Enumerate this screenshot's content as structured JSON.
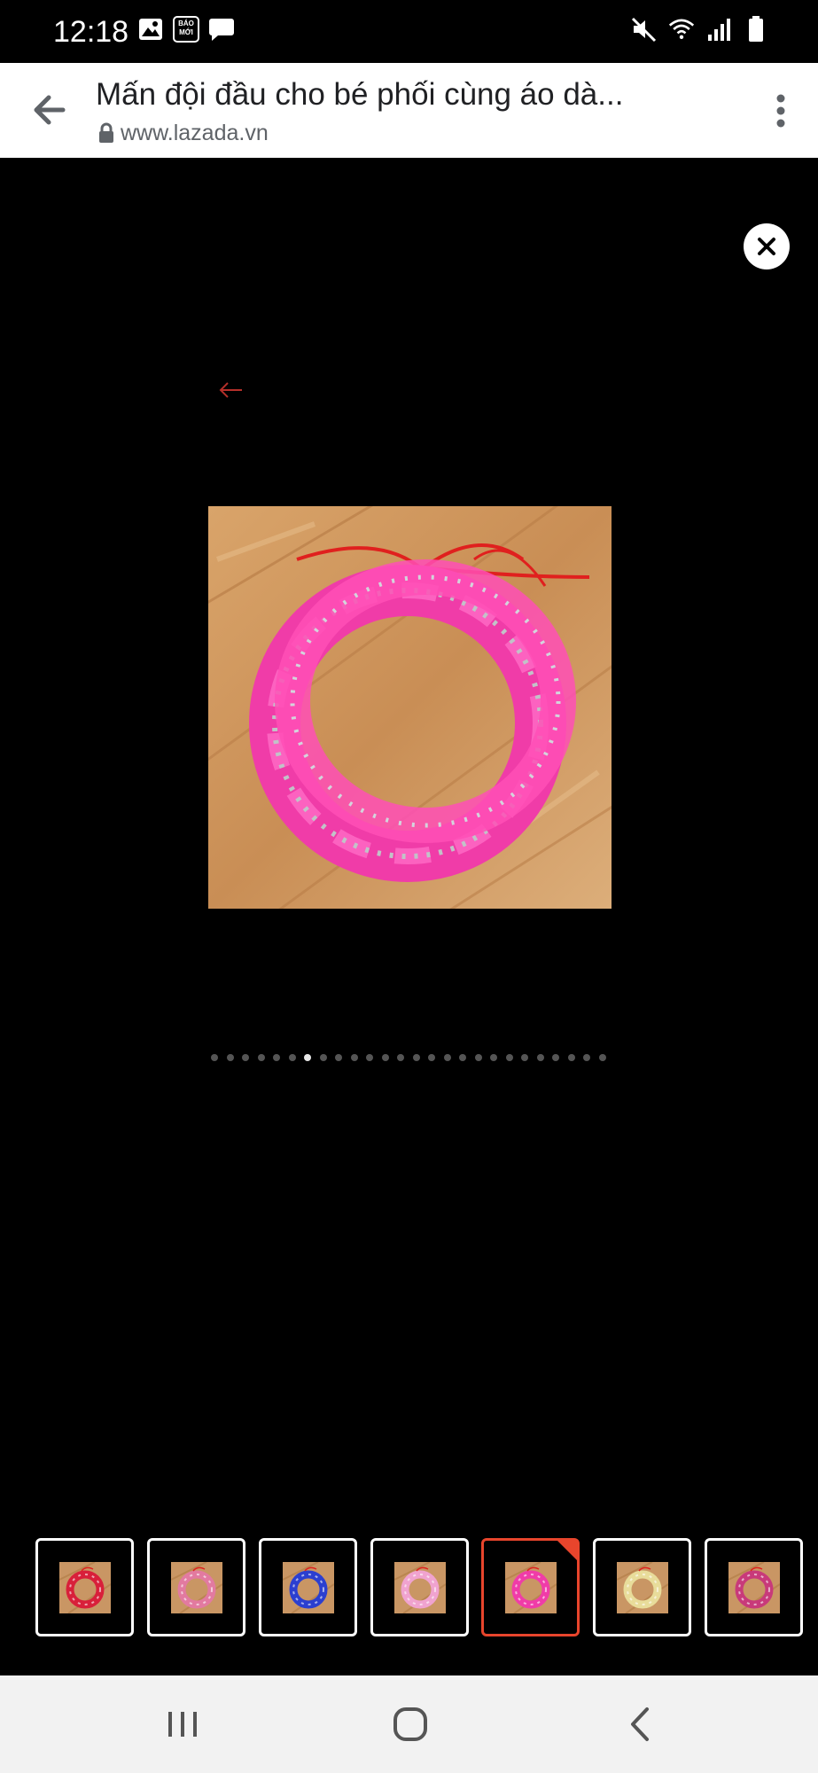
{
  "status_bar": {
    "time": "12:18",
    "left_icons": [
      "image-icon",
      "baomoi-icon",
      "message-icon"
    ],
    "baomoi_line1": "BÁO",
    "baomoi_line2": "MỚI",
    "right_icons": [
      "mute-icon",
      "wifi-icon",
      "signal-icon",
      "battery-icon"
    ]
  },
  "browser": {
    "title": "Mấn đội đầu cho bé phối cùng áo dà...",
    "url": "www.lazada.vn",
    "back_icon": "arrow-left-icon",
    "lock_icon": "lock-icon",
    "menu_icon": "more-vertical-icon"
  },
  "gallery": {
    "close_icon": "close-icon",
    "prev_icon": "arrow-left-icon",
    "main_image": "pink-braided-headband-photo",
    "dot_count": 26,
    "active_dot": 6,
    "thumbnails": [
      {
        "image": "red-braided-headband",
        "color": "#d8203a",
        "selected": false
      },
      {
        "image": "pink-white-braided-headband",
        "color": "#e27aa0",
        "selected": false
      },
      {
        "image": "blue-braided-headband",
        "color": "#2b3fd0",
        "selected": false
      },
      {
        "image": "light-pink-braided-headband",
        "color": "#f0a3cf",
        "selected": false
      },
      {
        "image": "hot-pink-braided-headband",
        "color": "#f03ca8",
        "selected": true
      },
      {
        "image": "cream-braided-headband",
        "color": "#e8dc9a",
        "selected": false
      },
      {
        "image": "red-blue-braided-headband",
        "color": "#c83a7a",
        "selected": false
      }
    ],
    "accent_color": "#e8452c"
  },
  "nav_bar": {
    "recents_icon": "recents-icon",
    "home_icon": "home-icon",
    "back_icon": "back-chevron-icon"
  }
}
